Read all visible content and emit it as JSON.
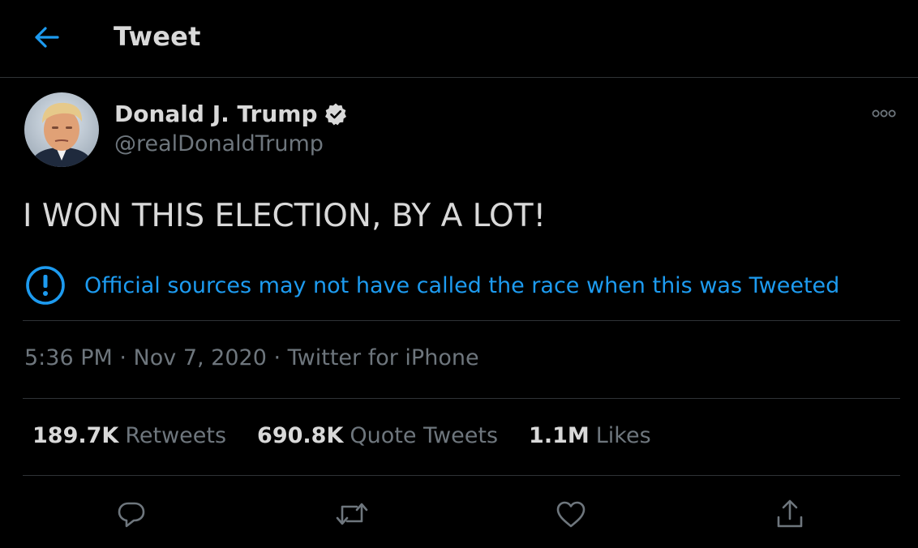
{
  "header": {
    "title": "Tweet",
    "back_icon": "back-arrow-icon",
    "accent_color": "#1d9bf0"
  },
  "tweet": {
    "author": {
      "display_name": "Donald J. Trump",
      "handle": "@realDonaldTrump",
      "verified": true,
      "verified_icon": "verified-badge-icon"
    },
    "more_icon": "more-options-icon",
    "text": "I WON THIS ELECTION, BY A LOT!",
    "notice": {
      "icon": "exclamation-circle-icon",
      "text": "Official sources may not have called the race when this was Tweeted"
    },
    "meta": {
      "time": "5:36 PM",
      "separator": " · ",
      "date": "Nov 7, 2020",
      "source": "Twitter for iPhone"
    },
    "stats": [
      {
        "value": "189.7K",
        "label": "Retweets"
      },
      {
        "value": "690.8K",
        "label": "Quote Tweets"
      },
      {
        "value": "1.1M",
        "label": "Likes"
      }
    ],
    "actions": [
      "reply-icon",
      "retweet-icon",
      "like-icon",
      "share-icon"
    ]
  }
}
